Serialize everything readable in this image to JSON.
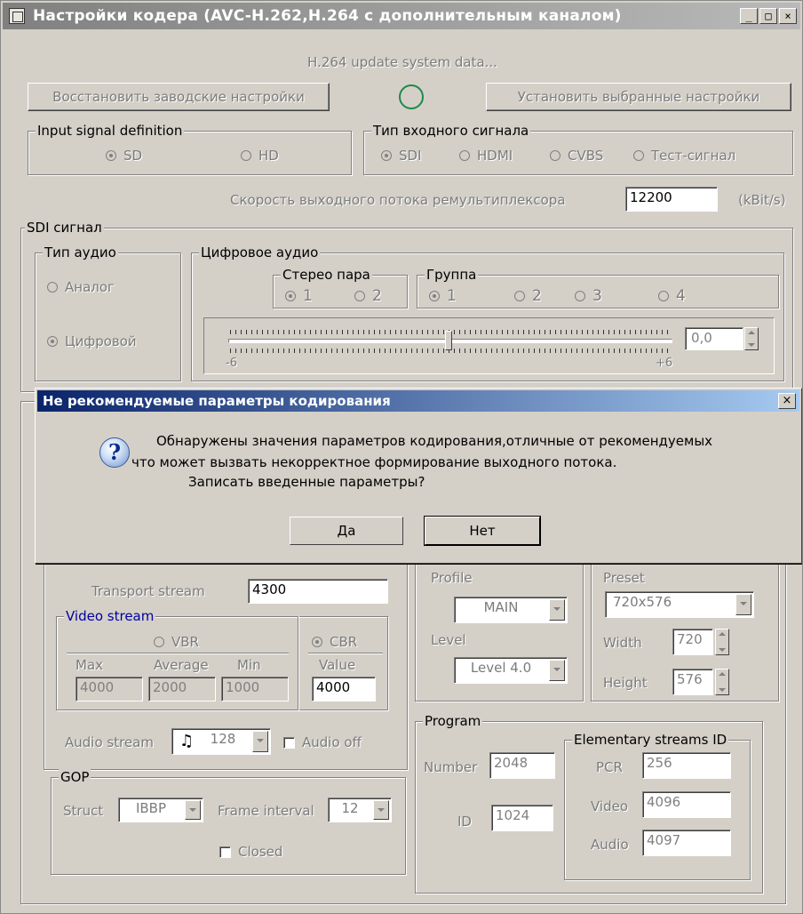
{
  "window": {
    "title": "Настройки кодера (AVC-H.262,H.264 с дополнительным каналом)",
    "buttons": {
      "minimize": "_",
      "maximize": "□",
      "close": "×"
    }
  },
  "top": {
    "status": "H.264 update system data...",
    "restore_button": "Восстановить заводские настройки",
    "apply_button": "Установить выбранные настройки"
  },
  "input_signal_definition": {
    "caption": "Input signal definition",
    "options": [
      "SD",
      "HD"
    ],
    "selected": "SD"
  },
  "input_signal_type": {
    "caption": "Тип входного сигнала",
    "options": [
      "SDI",
      "HDMI",
      "CVBS",
      "Тест-сигнал"
    ],
    "selected": "SDI"
  },
  "remux": {
    "label": "Скорость выходного потока ремультиплексора",
    "value": "12200",
    "unit": "(kBit/s)"
  },
  "sdi": {
    "caption": "SDI сигнал",
    "audio_type": {
      "caption": "Тип аудио",
      "options": [
        "Аналог",
        "Цифровой"
      ],
      "selected": "Цифровой"
    },
    "digital_audio": {
      "caption": "Цифровое аудио",
      "stereo_pair": {
        "caption": "Стерео пара",
        "options": [
          "1",
          "2"
        ],
        "selected": "1"
      },
      "group": {
        "caption": "Группа",
        "options": [
          "1",
          "2",
          "3",
          "4"
        ],
        "selected": "1"
      },
      "slider": {
        "min_label": "-6",
        "max_label": "+6",
        "value": "0,0"
      }
    }
  },
  "bitrate": {
    "transport_label": "Transport stream",
    "transport_value": "4300",
    "video_stream": {
      "caption": "Video stream",
      "vbr_label": "VBR",
      "cbr_label": "CBR",
      "selected": "CBR",
      "max_label": "Max",
      "avg_label": "Average",
      "min_label": "Min",
      "value_label": "Value",
      "max": "4000",
      "avg": "2000",
      "min": "1000",
      "value": "4000"
    },
    "audio_label": "Audio stream",
    "audio_value": "128",
    "audio_off_label": "Audio off"
  },
  "gop": {
    "caption": "GOP",
    "struct_label": "Struct",
    "struct_value": "IBBP",
    "interval_label": "Frame interval",
    "interval_value": "12",
    "closed_label": "Closed"
  },
  "codec": {
    "profile_label": "Profile",
    "profile_value": "MAIN",
    "level_label": "Level",
    "level_value": "Level 4.0"
  },
  "resolution": {
    "preset_label": "Preset",
    "preset_value": "720x576",
    "width_label": "Width",
    "width_value": "720",
    "height_label": "Height",
    "height_value": "576"
  },
  "program": {
    "caption": "Program",
    "number_label": "Number",
    "number_value": "2048",
    "id_label": "ID",
    "id_value": "1024",
    "es": {
      "caption": "Elementary streams ID",
      "pcr_label": "PCR",
      "pcr_value": "256",
      "video_label": "Video",
      "video_value": "4096",
      "audio_label": "Audio",
      "audio_value": "4097"
    }
  },
  "dialog": {
    "title": "Не рекомендуемые параметры кодирования",
    "close": "×",
    "icon": "question-icon",
    "line1": "Обнаружены значения  параметров кодирования,отличные от рекомендуемых",
    "line2": "что может вызвать  некорректное формирование выходного потока.",
    "line3": "Записать введенные параметры?",
    "yes": "Да",
    "no": "Нет"
  },
  "colors": {
    "face": "#d4d0c8",
    "dialog_title_start": "#0a246a",
    "dialog_title_end": "#a6caf0"
  }
}
